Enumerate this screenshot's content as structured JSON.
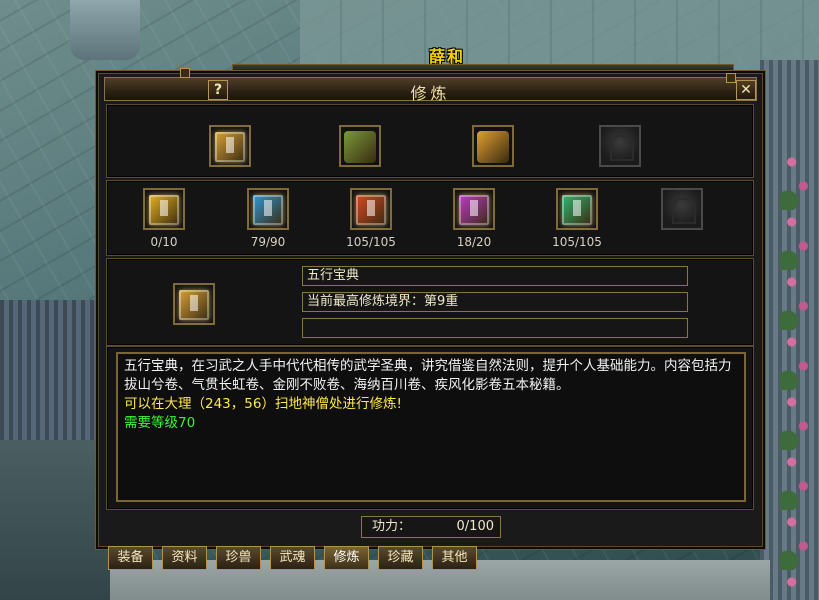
{
  "npc_name": "薛和",
  "window": {
    "title": "修炼",
    "help_label": "?",
    "close_label": "✕"
  },
  "top_items": [
    {
      "icon": "golden-book-icon",
      "color": "#d8a23a"
    },
    {
      "icon": "bundle-icon",
      "color": "#7a9a3a"
    },
    {
      "icon": "treasure-icon",
      "color": "#e0a030"
    },
    {
      "icon": "empty-slot-icon"
    }
  ],
  "skill_books": [
    {
      "icon": "yellow-book-icon",
      "color": "#e6b421",
      "progress": "0/10"
    },
    {
      "icon": "blue-book-icon",
      "color": "#2f9ad8",
      "progress": "79/90"
    },
    {
      "icon": "red-book-icon",
      "color": "#d84a22",
      "progress": "105/105"
    },
    {
      "icon": "purple-book-icon",
      "color": "#c03ad0",
      "progress": "18/20"
    },
    {
      "icon": "green-book-icon",
      "color": "#2fb873",
      "progress": "105/105"
    },
    {
      "icon": "empty-slot-icon",
      "progress": ""
    }
  ],
  "selected": {
    "icon": "golden-book-icon",
    "name": "五行宝典",
    "realm": "当前最高修炼境界：第9重",
    "extra": ""
  },
  "description": {
    "text": "五行宝典，在习武之人手中代代相传的武学圣典，讲究借鉴自然法则，提升个人基础能力。内容包括力拔山兮卷、气贯长虹卷、金刚不败卷、海纳百川卷、疾风化影卷五本秘籍。",
    "location_hint": "可以在大理（243，56）扫地神僧处进行修炼!",
    "requirement": "需要等级70"
  },
  "power": {
    "label": "功力：",
    "value": "0/100"
  },
  "tabs": [
    {
      "label": "装备"
    },
    {
      "label": "资料"
    },
    {
      "label": "珍兽"
    },
    {
      "label": "武魂"
    },
    {
      "label": "修炼",
      "active": true
    },
    {
      "label": "珍藏"
    },
    {
      "label": "其他"
    }
  ]
}
